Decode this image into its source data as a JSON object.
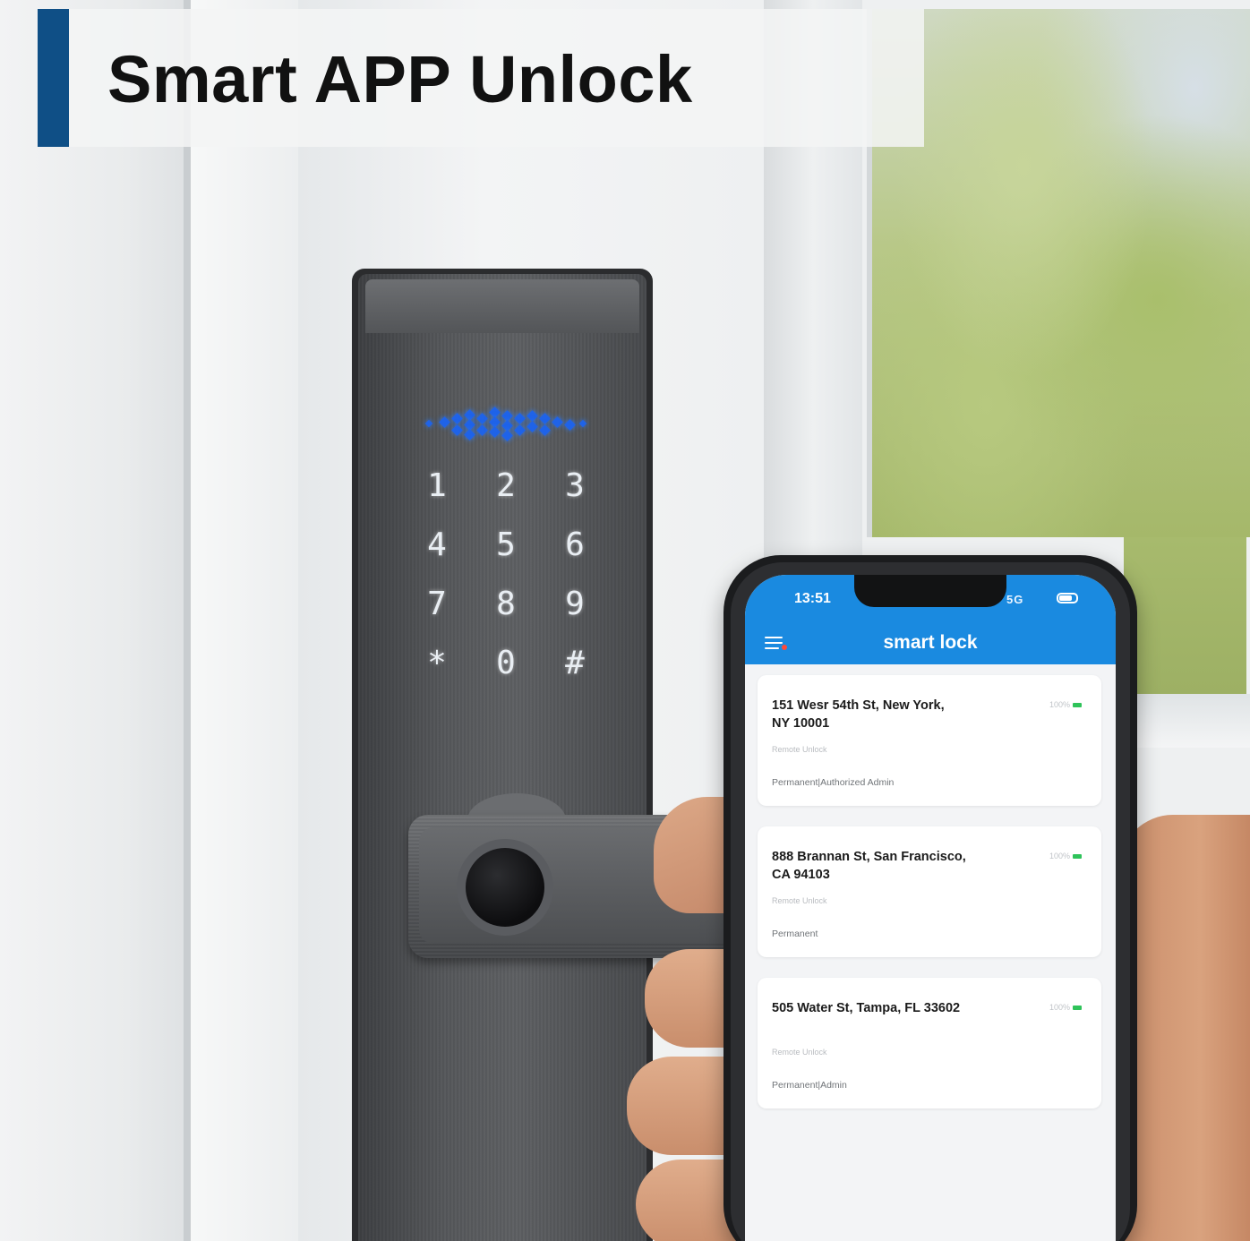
{
  "banner": {
    "title": "Smart APP Unlock"
  },
  "keypad": {
    "keys": [
      "1",
      "2",
      "3",
      "4",
      "5",
      "6",
      "7",
      "8",
      "9",
      "*",
      "0",
      "#"
    ]
  },
  "phone": {
    "status": {
      "time": "13:51",
      "network": "5G"
    },
    "app": {
      "title": "smart lock",
      "locks": [
        {
          "address_line1": "151 Wesr 54th St, New York,",
          "address_line2": "NY 10001",
          "battery": "100%",
          "mode": "Remote Unlock",
          "role": "Permanent|Authorized Admin"
        },
        {
          "address_line1": "888 Brannan St, San Francisco,",
          "address_line2": "CA 94103",
          "battery": "100%",
          "mode": "Remote Unlock",
          "role": "Permanent"
        },
        {
          "address_line1": "505 Water St, Tampa, FL 33602",
          "address_line2": "",
          "battery": "100%",
          "mode": "Remote Unlock",
          "role": "Permanent|Admin"
        }
      ]
    }
  },
  "colors": {
    "banner_accent": "#0f4f86",
    "app_bar": "#1a8ae0",
    "battery_ok": "#2fc35a",
    "keypad_light": "#1f63e8"
  },
  "icons": [
    "menu-icon",
    "battery-icon",
    "fingerprint-sensor-icon",
    "signal-icon"
  ]
}
